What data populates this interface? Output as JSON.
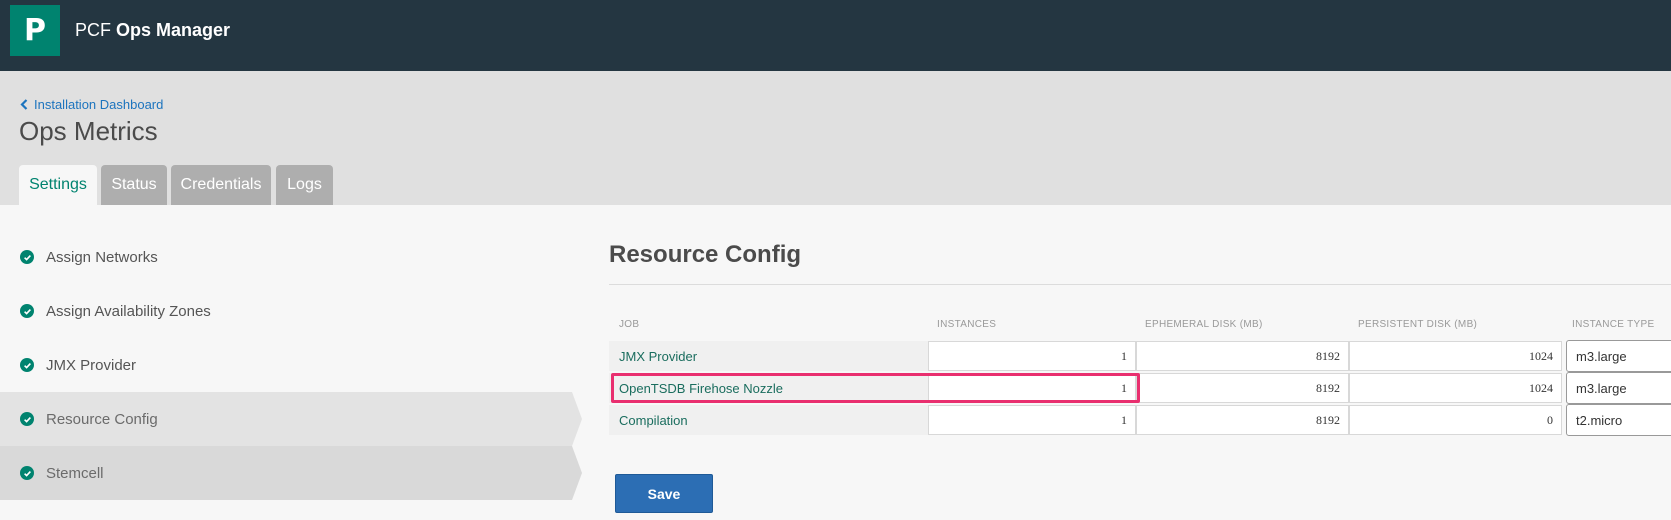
{
  "header": {
    "logo_letter": "P",
    "app_name_prefix": "PCF",
    "app_name_strong": "Ops Manager"
  },
  "breadcrumb": {
    "label": "Installation Dashboard"
  },
  "page_title": "Ops Metrics",
  "tabs": [
    {
      "label": "Settings",
      "active": true
    },
    {
      "label": "Status",
      "active": false
    },
    {
      "label": "Credentials",
      "active": false
    },
    {
      "label": "Logs",
      "active": false
    }
  ],
  "sidebar": {
    "items": [
      {
        "label": "Assign Networks",
        "status": "complete"
      },
      {
        "label": "Assign Availability Zones",
        "status": "complete"
      },
      {
        "label": "JMX Provider",
        "status": "complete"
      },
      {
        "label": "Resource Config",
        "status": "complete",
        "current": true
      },
      {
        "label": "Stemcell",
        "status": "complete"
      }
    ]
  },
  "resource_config": {
    "title": "Resource Config",
    "columns": [
      "JOB",
      "INSTANCES",
      "EPHEMERAL DISK (MB)",
      "PERSISTENT DISK (MB)",
      "INSTANCE TYPE"
    ],
    "rows": [
      {
        "job": "JMX Provider",
        "instances": "1",
        "ephemeral_disk": "8192",
        "persistent_disk": "1024",
        "instance_type": "m3.large"
      },
      {
        "job": "OpenTSDB Firehose Nozzle",
        "instances": "1",
        "ephemeral_disk": "8192",
        "persistent_disk": "1024",
        "instance_type": "m3.large"
      },
      {
        "job": "Compilation",
        "instances": "1",
        "ephemeral_disk": "8192",
        "persistent_disk": "0",
        "instance_type": "t2.micro"
      }
    ],
    "save_label": "Save"
  },
  "colors": {
    "topbar": "#243641",
    "brand": "#00836f",
    "link": "#1c74be",
    "highlight": "#e92f6f",
    "save": "#2c6eb4"
  }
}
